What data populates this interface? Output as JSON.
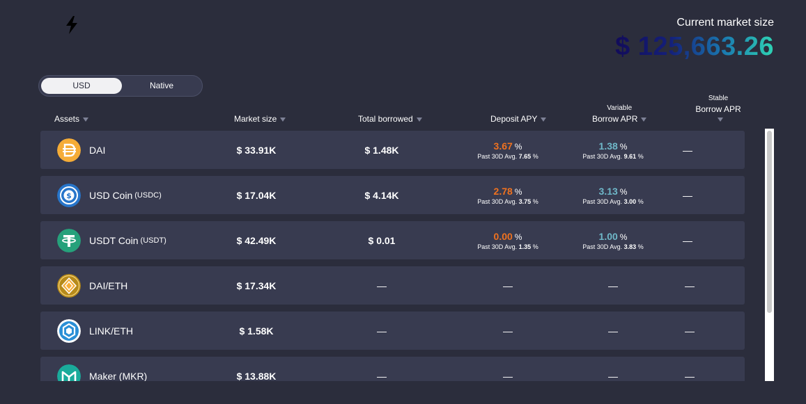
{
  "market": {
    "title": "Current market size",
    "value": "$ 125,663.26"
  },
  "toggle": {
    "usd_label": "USD",
    "native_label": "Native",
    "selected": "USD"
  },
  "columns": {
    "assets": "Assets",
    "market_size": "Market size",
    "total_borrowed": "Total borrowed",
    "deposit_apy": "Deposit APY",
    "variable_sub": "Variable",
    "variable_label": "Borrow APR",
    "stable_sub": "Stable",
    "stable_label": "Borrow APR"
  },
  "colors": {
    "deposit_apy": "#f0721f",
    "variable_apr": "#6fb8c9",
    "row_bg": "#383b50",
    "page_bg": "#2b2d3c"
  },
  "rows": [
    {
      "name": "DAI",
      "symbol": "",
      "icon": "dai-icon",
      "market_size": "$ 33.91K",
      "total_borrowed": "$ 1.48K",
      "deposit_apy": "3.67",
      "deposit_pct": "%",
      "deposit_avg_label": "Past 30D Avg.",
      "deposit_avg": "7.65",
      "deposit_avg_pct": "%",
      "variable_apr": "1.38",
      "variable_pct": "%",
      "variable_avg_label": "Past 30D Avg.",
      "variable_avg": "9.61",
      "variable_avg_pct": "%",
      "stable_apr": "—"
    },
    {
      "name": "USD Coin",
      "symbol": "(USDC)",
      "icon": "usdc-icon",
      "market_size": "$ 17.04K",
      "total_borrowed": "$ 4.14K",
      "deposit_apy": "2.78",
      "deposit_pct": "%",
      "deposit_avg_label": "Past 30D Avg.",
      "deposit_avg": "3.75",
      "deposit_avg_pct": "%",
      "variable_apr": "3.13",
      "variable_pct": "%",
      "variable_avg_label": "Past 30D Avg.",
      "variable_avg": "3.00",
      "variable_avg_pct": "%",
      "stable_apr": "—"
    },
    {
      "name": "USDT Coin",
      "symbol": "(USDT)",
      "icon": "usdt-icon",
      "market_size": "$ 42.49K",
      "total_borrowed": "$ 0.01",
      "deposit_apy": "0.00",
      "deposit_pct": "%",
      "deposit_avg_label": "Past 30D Avg.",
      "deposit_avg": "1.35",
      "deposit_avg_pct": "%",
      "variable_apr": "1.00",
      "variable_pct": "%",
      "variable_avg_label": "Past 30D Avg.",
      "variable_avg": "3.83",
      "variable_avg_pct": "%",
      "stable_apr": "—"
    },
    {
      "name": "DAI/ETH",
      "symbol": "",
      "icon": "dai-eth-icon",
      "market_size": "$ 17.34K",
      "total_borrowed": "—",
      "deposit_dash": "—",
      "variable_dash": "—",
      "stable_apr": "—"
    },
    {
      "name": "LINK/ETH",
      "symbol": "",
      "icon": "link-eth-icon",
      "market_size": "$ 1.58K",
      "total_borrowed": "—",
      "deposit_dash": "—",
      "variable_dash": "—",
      "stable_apr": "—"
    },
    {
      "name": "Maker (MKR)",
      "symbol": "",
      "icon": "mkr-icon",
      "market_size": "$ 13.88K",
      "total_borrowed": "—",
      "deposit_dash": "—",
      "variable_dash": "—",
      "stable_apr": "—"
    }
  ]
}
